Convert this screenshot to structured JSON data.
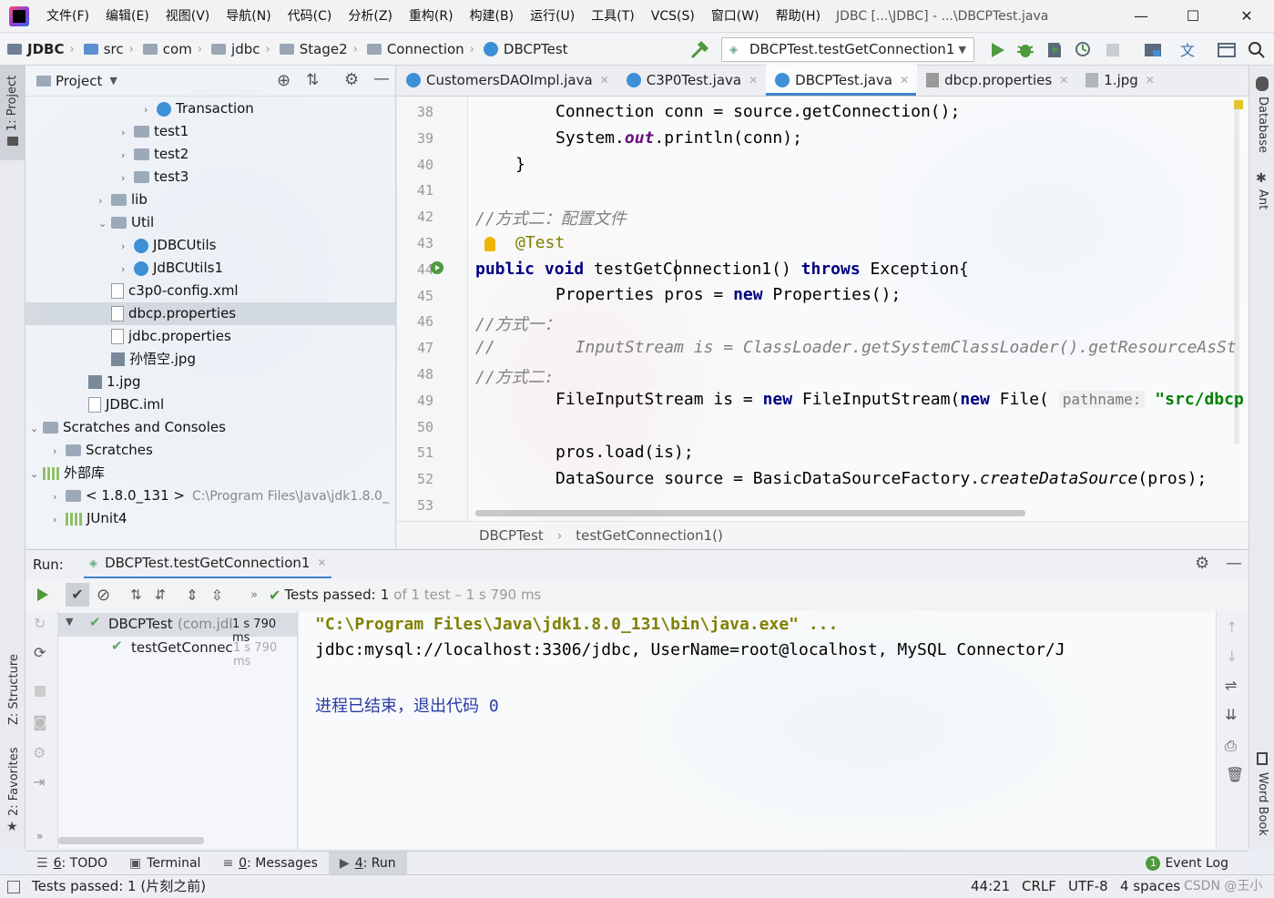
{
  "app": {
    "title": "JDBC [...\\JDBC] - ...\\DBCPTest.java",
    "menu": [
      "文件(F)",
      "编辑(E)",
      "视图(V)",
      "导航(N)",
      "代码(C)",
      "分析(Z)",
      "重构(R)",
      "构建(B)",
      "运行(U)",
      "工具(T)",
      "VCS(S)",
      "窗口(W)",
      "帮助(H)"
    ]
  },
  "navbar": {
    "breadcrumbs": [
      "JDBC",
      "src",
      "com",
      "jdbc",
      "Stage2",
      "Connection",
      "DBCPTest"
    ],
    "run_config": "DBCPTest.testGetConnection1"
  },
  "side_tools": {
    "left_top": "1: Project",
    "left_mid": "Z: Structure",
    "left_bottom": "2: Favorites",
    "right_top": "Database",
    "right_mid": "Ant",
    "right_bottom": "Word Book"
  },
  "project": {
    "title": "Project",
    "items": [
      {
        "label": "Transaction",
        "type": "class-folder",
        "arrow": "›"
      },
      {
        "label": "test1",
        "type": "folder",
        "arrow": "›"
      },
      {
        "label": "test2",
        "type": "folder",
        "arrow": "›"
      },
      {
        "label": "test3",
        "type": "folder",
        "arrow": "›"
      },
      {
        "label": "lib",
        "type": "folder",
        "arrow": "›"
      },
      {
        "label": "Util",
        "type": "folder",
        "arrow": "⌄"
      },
      {
        "label": "JDBCUtils",
        "type": "class",
        "arrow": "›"
      },
      {
        "label": "JdBCUtils1",
        "type": "class",
        "arrow": "›"
      },
      {
        "label": "c3p0-config.xml",
        "type": "xml",
        "arrow": ""
      },
      {
        "label": "dbcp.properties",
        "type": "file",
        "arrow": ""
      },
      {
        "label": "jdbc.properties",
        "type": "file",
        "arrow": ""
      },
      {
        "label": "孙悟空.jpg",
        "type": "img",
        "arrow": ""
      },
      {
        "label": "1.jpg",
        "type": "img",
        "arrow": ""
      },
      {
        "label": "JDBC.iml",
        "type": "file",
        "arrow": ""
      },
      {
        "label": "Scratches and Consoles",
        "type": "scratch",
        "arrow": "⌄"
      },
      {
        "label": "Scratches",
        "type": "folder",
        "arrow": "›"
      },
      {
        "label": "外部库",
        "type": "lib",
        "arrow": "⌄"
      },
      {
        "label": "< 1.8.0_131 >",
        "extra": "C:\\Program Files\\Java\\jdk1.8.0_",
        "type": "folder",
        "arrow": "›"
      },
      {
        "label": "JUnit4",
        "type": "lib",
        "arrow": "›"
      }
    ]
  },
  "editor": {
    "tabs": [
      "CustomersDAOImpl.java",
      "C3P0Test.java",
      "DBCPTest.java",
      "dbcp.properties",
      "1.jpg"
    ],
    "active_tab": "DBCPTest.java",
    "line_numbers": [
      "38",
      "39",
      "40",
      "41",
      "42",
      "43",
      "44",
      "45",
      "46",
      "47",
      "48",
      "49",
      "50",
      "51",
      "52",
      "53"
    ],
    "lines": {
      "l38_a": "Connection conn = source.getConnection();",
      "l39_a": "System.",
      "l39_b": "out",
      "l39_c": ".println(conn);",
      "l40_a": "}",
      "l42_a": "//方式二：配置文件",
      "l43_a": "@Test",
      "l44_a": "public void",
      "l44_b": " testGetConnection1() ",
      "l44_c": "throws",
      "l44_d": " Exception{",
      "l45_a": "Properties pros = ",
      "l45_b": "new",
      "l45_c": " Properties();",
      "l46_a": "//方式一：",
      "l47_a": "//",
      "l47_b": "InputStream is = ClassLoader.getSystemClassLoader().getResourceAsSt",
      "l48_a": "//方式二:",
      "l49_a": "FileInputStream is = ",
      "l49_b": "new",
      "l49_c": " FileInputStream(",
      "l49_d": "new",
      "l49_e": " File(",
      "l49_hint": "pathname:",
      "l49_str": "\"src/dbcp",
      "l51_a": "pros.load(is);",
      "l52_a": "DataSource source = BasicDataSourceFactory.",
      "l52_b": "createDataSource",
      "l52_c": "(pros);"
    },
    "breadcrumb": [
      "DBCPTest",
      "testGetConnection1()"
    ]
  },
  "run": {
    "label": "Run:",
    "config_tab": "DBCPTest.testGetConnection1",
    "status_prefix": "Tests passed:",
    "status_count": "1",
    "status_rest": "of 1 test – 1 s 790 ms",
    "tree": [
      {
        "label": "DBCPTest",
        "detail": "(com.jdl",
        "time": "1 s 790 ms"
      },
      {
        "label": "testGetConnec",
        "time": "1 s 790 ms"
      }
    ],
    "console": [
      "\"C:\\Program Files\\Java\\jdk1.8.0_131\\bin\\java.exe\" ...",
      "jdbc:mysql://localhost:3306/jdbc, UserName=root@localhost, MySQL Connector/J",
      "进程已结束，退出代码 0"
    ]
  },
  "bottom_tabs": [
    {
      "num": "6",
      "label": ": TODO"
    },
    {
      "num": "",
      "label": "Terminal"
    },
    {
      "num": "0",
      "label": ": Messages"
    },
    {
      "num": "4",
      "label": ": Run"
    }
  ],
  "event_log": {
    "badge": "1",
    "label": "Event Log"
  },
  "status": {
    "message": "Tests passed: 1 (片刻之前)",
    "position": "44:21",
    "line_sep": "CRLF",
    "encoding": "UTF-8",
    "indent": "4 spaces",
    "watermark": "CSDN @王小聪"
  },
  "colors": {
    "accent": "#4083c9",
    "keyword": "#000080",
    "comment": "#808080",
    "annotation": "#808000",
    "string": "#008000",
    "pass_green": "#59a869",
    "console_path": "#808000"
  }
}
